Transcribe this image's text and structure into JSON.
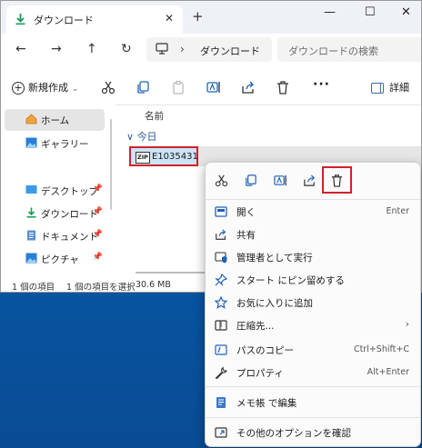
{
  "window": {
    "tab_title": "ダウンロード",
    "close_tab": "✕",
    "new_tab": "+",
    "minimize": "—",
    "maximize": "☐",
    "close": "✕"
  },
  "address": {
    "location": "ダウンロード",
    "separator": "›",
    "search_placeholder": "ダウンロードの検索"
  },
  "nav_buttons": {
    "back": "←",
    "forward": "→",
    "up": "↑",
    "refresh": "↻"
  },
  "toolbar": {
    "new_label": "新規作成",
    "more": "···",
    "details_label": "詳細"
  },
  "sidebar": {
    "items": [
      {
        "label": "ホーム",
        "icon": "home-icon"
      },
      {
        "label": "ギャラリー",
        "icon": "gallery-icon"
      },
      {
        "label": "デスクトップ",
        "icon": "desktop-icon"
      },
      {
        "label": "ダウンロード",
        "icon": "download-icon"
      },
      {
        "label": "ドキュメント",
        "icon": "document-icon"
      },
      {
        "label": "ピクチャ",
        "icon": "picture-icon"
      }
    ]
  },
  "content": {
    "column_name": "名前",
    "group_label": "今日",
    "group_chevron": "∨",
    "file_name": "E1035431",
    "file_icon_text": "ZIP"
  },
  "status": {
    "count": "1 個の項目",
    "selected": "1 個の項目を選択",
    "size": "30.6 MB"
  },
  "context_menu": {
    "items": [
      {
        "label": "開く",
        "shortcut": "Enter",
        "icon": "open-icon"
      },
      {
        "label": "共有",
        "shortcut": "",
        "icon": "share-icon"
      },
      {
        "label": "管理者として実行",
        "shortcut": "",
        "icon": "shield-icon"
      },
      {
        "label": "スタート にピン留めする",
        "shortcut": "",
        "icon": "pin-icon"
      },
      {
        "label": "お気に入りに追加",
        "shortcut": "",
        "icon": "star-icon"
      },
      {
        "label": "圧縮先...",
        "shortcut": "",
        "icon": "compress-icon",
        "submenu": "›"
      },
      {
        "label": "パスのコピー",
        "shortcut": "Ctrl+Shift+C",
        "icon": "copy-path-icon"
      },
      {
        "label": "プロパティ",
        "shortcut": "Alt+Enter",
        "icon": "wrench-icon"
      },
      {
        "label": "メモ帳 で編集",
        "shortcut": "",
        "icon": "notepad-icon"
      },
      {
        "label": "その他のオプションを確認",
        "shortcut": "",
        "icon": "more-options-icon"
      }
    ]
  },
  "colors": {
    "accent": "#0067c0",
    "highlight_border": "#d3212a",
    "selection": "#cce4f7"
  }
}
